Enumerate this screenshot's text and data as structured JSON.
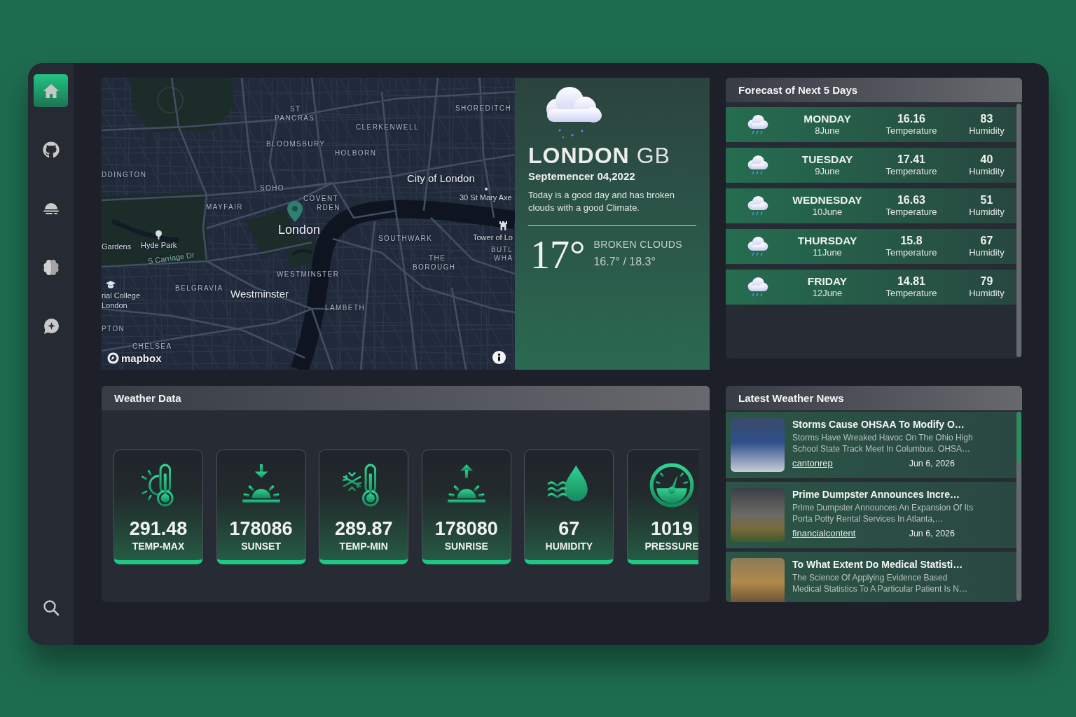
{
  "sidebar": {
    "items": [
      {
        "selected": true
      },
      {
        "selected": false
      },
      {
        "selected": false
      },
      {
        "selected": false
      },
      {
        "selected": false
      }
    ]
  },
  "map": {
    "labels": [
      {
        "text": "ST",
        "kind": "district"
      },
      {
        "text": "SHOREDITCH",
        "kind": "district"
      },
      {
        "text": "PANCRAS",
        "kind": "district"
      },
      {
        "text": "CLERKENWELL",
        "kind": "district"
      },
      {
        "text": "BLOOMSBURY",
        "kind": "district"
      },
      {
        "text": "HOLBORN",
        "kind": "district"
      },
      {
        "text": "DDINGTON",
        "kind": "district"
      },
      {
        "text": "City of London",
        "kind": "city"
      },
      {
        "text": "SOHO",
        "kind": "district"
      },
      {
        "text": "COVENT",
        "kind": "district"
      },
      {
        "text": "30 St Mary Axe",
        "kind": "poi"
      },
      {
        "text": "MAYFAIR",
        "kind": "district"
      },
      {
        "text": "RDEN",
        "kind": "district"
      },
      {
        "text": "London",
        "kind": "capital"
      },
      {
        "text": "SOUTHWARK",
        "kind": "district"
      },
      {
        "text": "Tower of Lo",
        "kind": "poi"
      },
      {
        "text": "Gardens",
        "kind": "poi"
      },
      {
        "text": "Hyde Park",
        "kind": "poi"
      },
      {
        "text": "BUTL",
        "kind": "district"
      },
      {
        "text": "S Carriage Dr",
        "kind": "road"
      },
      {
        "text": "THE",
        "kind": "district"
      },
      {
        "text": "WHA",
        "kind": "district"
      },
      {
        "text": "BOROUGH",
        "kind": "district"
      },
      {
        "text": "WESTMINSTER",
        "kind": "district"
      },
      {
        "text": "BELGRAVIA",
        "kind": "district"
      },
      {
        "text": "rial College",
        "kind": "poi"
      },
      {
        "text": "Westminster",
        "kind": "city"
      },
      {
        "text": "London",
        "kind": "poi"
      },
      {
        "text": "LAMBETH",
        "kind": "district"
      },
      {
        "text": "PTON",
        "kind": "district"
      },
      {
        "text": "CHELSEA",
        "kind": "district"
      }
    ],
    "attribution": "mapbox"
  },
  "current": {
    "city": "LONDON",
    "country": "GB",
    "date": "Septemencer 04,2022",
    "summary": "Today is a good day and has broken clouds with a good Climate.",
    "temperature": "17°",
    "condition": "BROKEN CLOUDS",
    "range": "16.7° / 18.3°"
  },
  "forecast": {
    "title": "Forecast of Next 5 Days",
    "days": [
      {
        "day": "MONDAY",
        "date": "8June",
        "temperature": "16.16",
        "temperature_label": "Temperature",
        "humidity": "83",
        "humidity_label": "Humidity"
      },
      {
        "day": "TUESDAY",
        "date": "9June",
        "temperature": "17.41",
        "temperature_label": "Temperature",
        "humidity": "40",
        "humidity_label": "Humidity"
      },
      {
        "day": "WEDNESDAY",
        "date": "10June",
        "temperature": "16.63",
        "temperature_label": "Temperature",
        "humidity": "51",
        "humidity_label": "Humidity"
      },
      {
        "day": "THURSDAY",
        "date": "11June",
        "temperature": "15.8",
        "temperature_label": "Temperature",
        "humidity": "67",
        "humidity_label": "Humidity"
      },
      {
        "day": "FRIDAY",
        "date": "12June",
        "temperature": "14.81",
        "temperature_label": "Temperature",
        "humidity": "79",
        "humidity_label": "Humidity"
      }
    ]
  },
  "weather_data": {
    "title": "Weather Data",
    "cards": [
      {
        "value": "291.48",
        "label": "TEMP-MAX"
      },
      {
        "value": "178086",
        "label": "SUNSET"
      },
      {
        "value": "289.87",
        "label": "TEMP-MIN"
      },
      {
        "value": "178080",
        "label": "SUNRISE"
      },
      {
        "value": "67",
        "label": "HUMIDITY"
      },
      {
        "value": "1019",
        "label": "PRESSURE"
      }
    ]
  },
  "news": {
    "title": "Latest Weather News",
    "articles": [
      {
        "title": "Storms Cause OHSAA To Modify O…",
        "description": "Storms Have Wreaked Havoc On The Ohio High School State Track Meet In Columbus. OHSA…",
        "source": "cantonrep",
        "date": "Jun 6, 2026"
      },
      {
        "title": "Prime Dumpster Announces Incre…",
        "description": "Prime Dumpster Announces An Expansion Of Its Porta Potty Rental Services In Atlanta,…",
        "source": "financialcontent",
        "date": "Jun 6, 2026"
      },
      {
        "title": "To What Extent Do Medical Statisti…",
        "description": "The Science Of Applying Evidence Based Medical Statistics To A Particular Patient Is N…"
      }
    ]
  }
}
